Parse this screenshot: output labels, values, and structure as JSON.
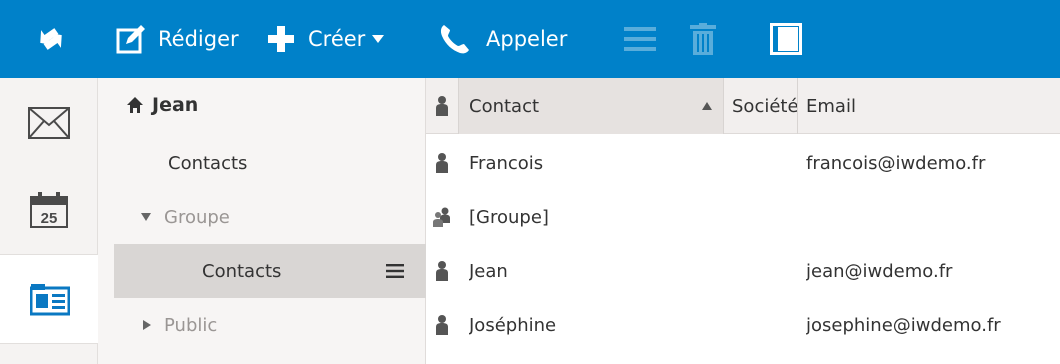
{
  "toolbar": {
    "compose_label": "Rédiger",
    "create_label": "Créer",
    "call_label": "Appeler"
  },
  "tree": {
    "root_label": "Jean",
    "items": [
      {
        "label": "Contacts"
      },
      {
        "label": "Groupe"
      },
      {
        "label": "Contacts"
      },
      {
        "label": "Public"
      }
    ]
  },
  "list": {
    "columns": {
      "contact": "Contact",
      "company": "Société",
      "email": "Email"
    },
    "rows": [
      {
        "name": "Francois",
        "type": "person",
        "company": "",
        "email": "francois@iwdemo.fr"
      },
      {
        "name": "[Groupe]",
        "type": "group",
        "company": "",
        "email": ""
      },
      {
        "name": "Jean",
        "type": "person",
        "company": "",
        "email": "jean@iwdemo.fr"
      },
      {
        "name": "Joséphine",
        "type": "person",
        "company": "",
        "email": "josephine@iwdemo.fr"
      }
    ]
  },
  "icons": {
    "refresh": "refresh-icon",
    "compose": "compose-icon",
    "create": "plus-icon",
    "call": "phone-icon",
    "menu": "list-menu-icon",
    "trash": "trash-icon",
    "panel": "panel-toggle-icon",
    "mail": "mail-icon",
    "calendar": "calendar-icon",
    "contacts": "contacts-icon"
  },
  "colors": {
    "toolbar": "#0081c9",
    "accent": "#0a78c2",
    "selected_tree_row": "#d9d6d4"
  },
  "calendar_day": "25"
}
